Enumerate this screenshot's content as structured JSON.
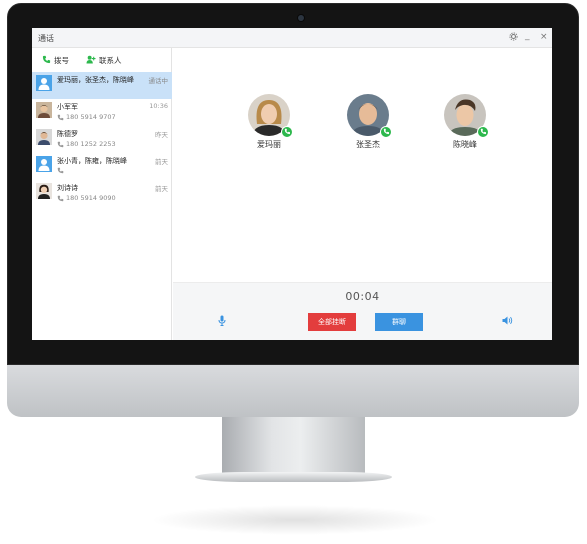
{
  "window": {
    "title": "通话"
  },
  "sidebar": {
    "tabs": [
      {
        "label": "拨号",
        "icon": "phone-icon"
      },
      {
        "label": "联系人",
        "icon": "add-contact-icon"
      }
    ],
    "calls": [
      {
        "name": "爱玛丽，张圣杰，陈晓峰",
        "phone": "",
        "time": "通话中",
        "avatar": "group-avatar",
        "active": true
      },
      {
        "name": "小军军",
        "phone": "180 5914 9707",
        "time": "10:36",
        "avatar": "photo-avatar"
      },
      {
        "name": "陈德罗",
        "phone": "180 1252 2253",
        "time": "昨天",
        "avatar": "photo-avatar"
      },
      {
        "name": "张小青，陈雍，陈晓峰",
        "phone": "",
        "time": "前天",
        "avatar": "group-avatar"
      },
      {
        "name": "刘诗诗",
        "phone": "180 5914 9090",
        "time": "前天",
        "avatar": "photo-avatar"
      }
    ]
  },
  "call": {
    "participants": [
      {
        "name": "爱玛丽"
      },
      {
        "name": "张圣杰"
      },
      {
        "name": "陈晓峰"
      }
    ],
    "timer": "00:04",
    "hangup_label": "全部挂断",
    "group_chat_label": "群聊"
  },
  "colors": {
    "accent": "#3a93e0",
    "danger": "#e33d3d",
    "online": "#2db84d",
    "selected": "#c9e1f8"
  }
}
